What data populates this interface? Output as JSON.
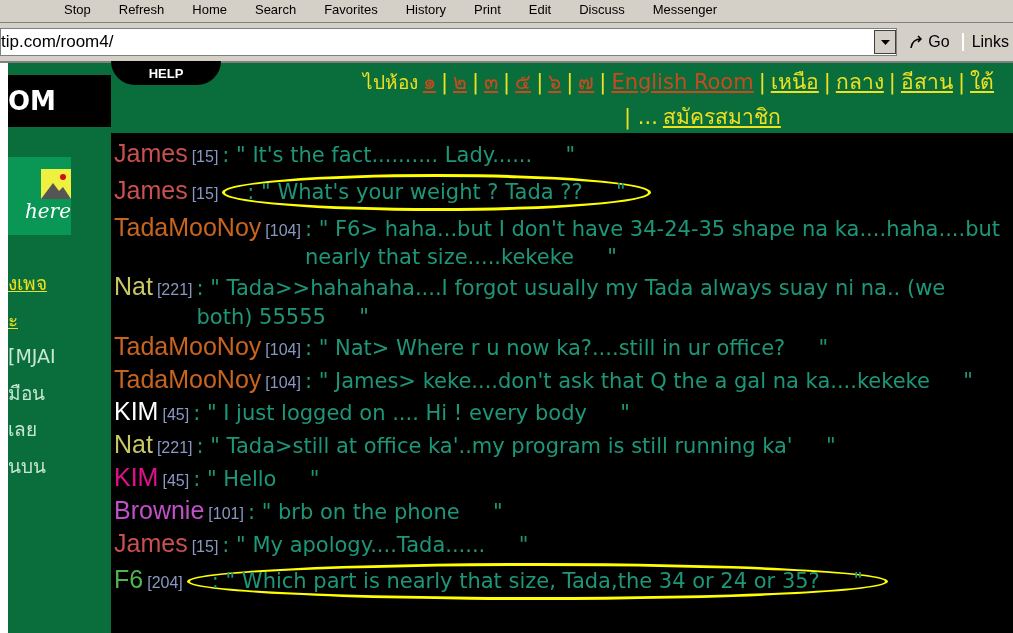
{
  "toolbar": {
    "buttons": [
      "Stop",
      "Refresh",
      "Home",
      "Search",
      "Favorites",
      "History",
      "Print",
      "Edit",
      "Discuss",
      "Messenger"
    ]
  },
  "address_bar": {
    "value": "tip.com/room4/",
    "go": "Go",
    "links": "Links"
  },
  "sidebar": {
    "logo": "OM",
    "banner": "here",
    "items": [
      {
        "label": "งเพจ",
        "kind": "link"
      },
      {
        "label": "ะ",
        "kind": "link"
      },
      {
        "label": "[MJAI",
        "kind": "text"
      },
      {
        "label": "มือน",
        "kind": "text"
      },
      {
        "label": "เลย",
        "kind": "text"
      },
      {
        "label": "นบน",
        "kind": "text"
      }
    ]
  },
  "header": {
    "help": "HELP",
    "goto": "ไปห้อง",
    "separator": "|",
    "more": "| ...",
    "signup": "สมัครสมาชิก",
    "rooms": [
      {
        "label": "๑",
        "kind": "number"
      },
      {
        "label": "๒",
        "kind": "number"
      },
      {
        "label": "๓",
        "kind": "number"
      },
      {
        "label": "๕",
        "kind": "number"
      },
      {
        "label": "๖",
        "kind": "number"
      },
      {
        "label": "๗",
        "kind": "number"
      },
      {
        "label": "English Room",
        "kind": "number"
      },
      {
        "label": "เหนือ",
        "kind": "region"
      },
      {
        "label": "กลาง",
        "kind": "region"
      },
      {
        "label": "อีสาน",
        "kind": "region"
      },
      {
        "label": "ใต้",
        "kind": "region"
      }
    ]
  },
  "messages": [
    {
      "name": "James",
      "id": "[15]",
      "text": ": \" It's the fact.......... Lady......     \"",
      "color": "#c85050",
      "highlighted": false
    },
    {
      "name": "James",
      "id": "[15]",
      "text": ": \" What's your weight ? Tada ??     \"",
      "color": "#c85050",
      "highlighted": true
    },
    {
      "name": "TadaMooNoy",
      "id": "[104]",
      "text": ": \" F6> haha...but I don't have 34-24-35 shape na ka....haha....but nearly that size.....kekeke     \"",
      "color": "#c8641e"
    },
    {
      "name": "Nat",
      "id": "[221]",
      "text": ": \" Tada>>hahahaha....I forgot usually my Tada always suay ni na.. (we both) 55555     \"",
      "color": "#c8c864"
    },
    {
      "name": "TadaMooNoy",
      "id": "[104]",
      "text": ": \" Nat> Where r u now ka?....still in ur office?     \"",
      "color": "#c8641e"
    },
    {
      "name": "TadaMooNoy",
      "id": "[104]",
      "text": ": \" James> keke....don't ask that Q the a gal na ka....kekeke     \"",
      "color": "#c8641e"
    },
    {
      "name": "KIM",
      "id": "[45]",
      "text": ": \" I just logged on .... Hi ! every body     \"",
      "color": "#ffffff"
    },
    {
      "name": "Nat",
      "id": "[221]",
      "text": ": \" Tada>still at office ka'..my program is still running ka'     \"",
      "color": "#c8c864"
    },
    {
      "name": "KIM",
      "id": "[45]",
      "text": ": \" Hello     \"",
      "color": "#e0108c"
    },
    {
      "name": "Brownie",
      "id": "[101]",
      "text": ": \" brb on the phone     \"",
      "color": "#c050c8"
    },
    {
      "name": "James",
      "id": "[15]",
      "text": ": \" My apology....Tada......     \"",
      "color": "#c85050"
    },
    {
      "name": "F6",
      "id": "[204]",
      "text": ": \" Which part is nearly that size, Tada,the 34 or 24 or 35?     \"",
      "color": "#50b450",
      "highlighted": true
    }
  ]
}
